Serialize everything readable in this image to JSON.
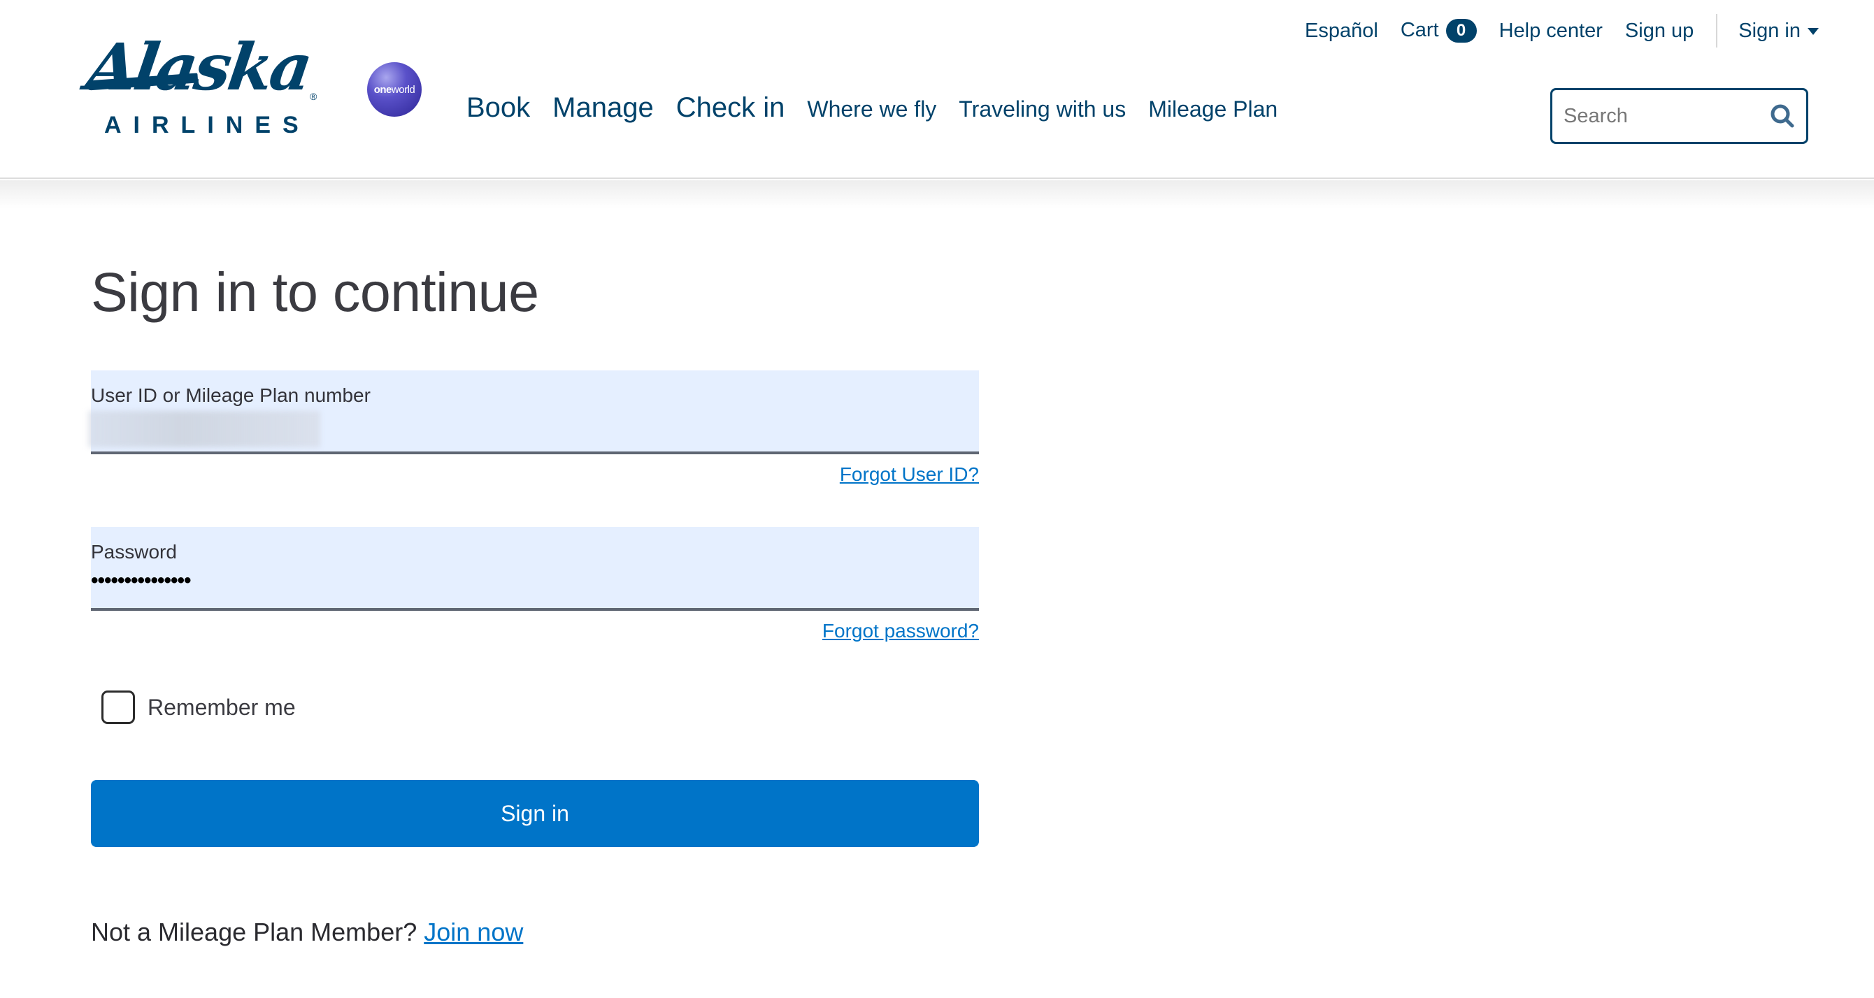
{
  "brand": {
    "logo_word": "Alaska",
    "logo_sub": "AIRLINES",
    "logo_reg": "®",
    "partner_bold": "one",
    "partner_rest": "world",
    "color_primary": "#01426a",
    "color_action": "#0074c8"
  },
  "utility_nav": {
    "espanol": "Español",
    "cart": "Cart",
    "cart_count": "0",
    "help_center": "Help center",
    "sign_up": "Sign up",
    "sign_in": "Sign in"
  },
  "main_nav": {
    "items": [
      {
        "label": "Book"
      },
      {
        "label": "Manage"
      },
      {
        "label": "Check in"
      },
      {
        "label": "Where we fly"
      },
      {
        "label": "Traveling with us"
      },
      {
        "label": "Mileage Plan"
      }
    ]
  },
  "search": {
    "placeholder": "Search",
    "value": "",
    "icon": "search-icon"
  },
  "form": {
    "title": "Sign in to continue",
    "user_field": {
      "label": "User ID or Mileage Plan number",
      "value_state": "redacted"
    },
    "forgot_user": "Forgot User ID?",
    "password_field": {
      "label": "Password",
      "masked_value": "•••••••••••••••"
    },
    "forgot_password": "Forgot password?",
    "remember_me": {
      "label": "Remember me",
      "checked": false
    },
    "submit_label": "Sign in",
    "join_prompt": "Not a Mileage Plan Member?",
    "join_link": "Join now"
  }
}
